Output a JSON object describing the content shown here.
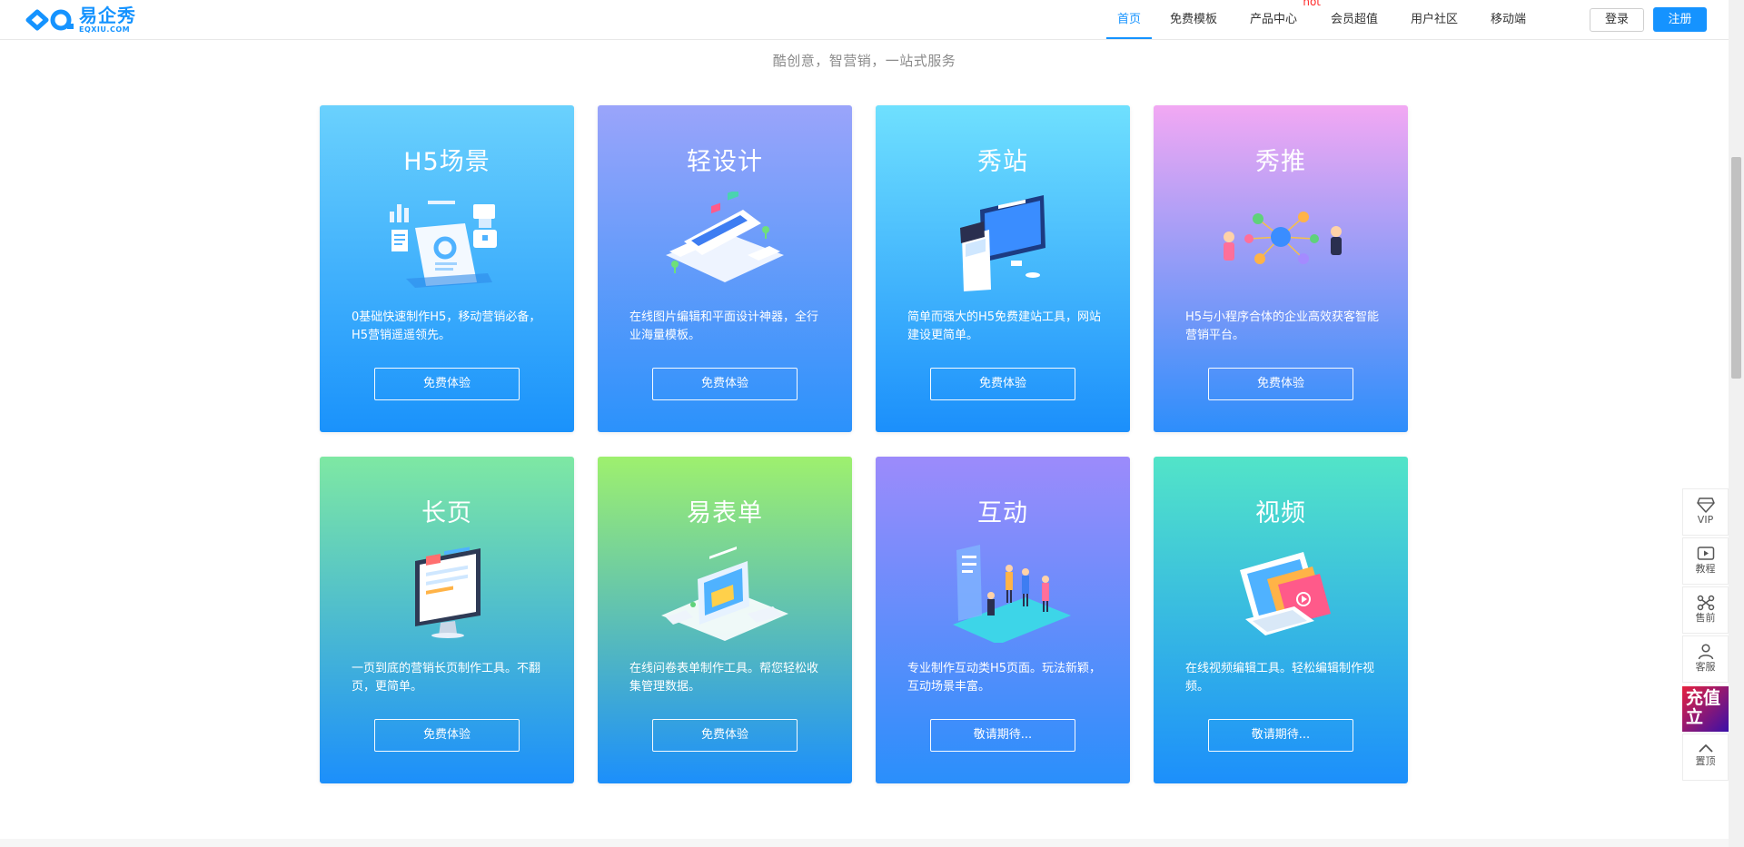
{
  "header": {
    "logo_cn": "易企秀",
    "logo_en": "EQXIU.COM",
    "nav": [
      {
        "label": "首页",
        "active": true
      },
      {
        "label": "免费模板",
        "active": false
      },
      {
        "label": "产品中心",
        "badge": "hot",
        "active": false
      },
      {
        "label": "会员超值",
        "active": false
      },
      {
        "label": "用户社区",
        "active": false
      },
      {
        "label": "移动端",
        "active": false
      }
    ],
    "login_label": "登录",
    "register_label": "注册"
  },
  "slogan": "酷创意，智营销，一站式服务",
  "cards": [
    {
      "title": "H5场景",
      "desc": "0基础快速制作H5，移动营销必备，H5营销遥遥领先。",
      "button": "免费体验",
      "icon": "h5-scene-illustration"
    },
    {
      "title": "轻设计",
      "desc": "在线图片编辑和平面设计神器，全行业海量模板。",
      "button": "免费体验",
      "icon": "light-design-illustration"
    },
    {
      "title": "秀站",
      "desc": "简单而强大的H5免费建站工具，网站建设更简单。",
      "button": "免费体验",
      "icon": "site-builder-illustration"
    },
    {
      "title": "秀推",
      "desc": "H5与小程序合体的企业高效获客智能营销平台。",
      "button": "免费体验",
      "icon": "marketing-network-illustration"
    },
    {
      "title": "长页",
      "desc": "一页到底的营销长页制作工具。不翻页，更简单。",
      "button": "免费体验",
      "icon": "long-page-illustration"
    },
    {
      "title": "易表单",
      "desc": "在线问卷表单制作工具。帮您轻松收集管理数据。",
      "button": "免费体验",
      "icon": "form-illustration"
    },
    {
      "title": "互动",
      "desc": "专业制作互动类H5页面。玩法新颖，互动场景丰富。",
      "button": "敬请期待...",
      "icon": "interactive-illustration"
    },
    {
      "title": "视频",
      "desc": "在线视频编辑工具。轻松编辑制作视频。",
      "button": "敬请期待...",
      "icon": "video-illustration"
    }
  ],
  "float_bar": {
    "vip": "VIP",
    "tutorial": "教程",
    "presale": "售前",
    "service": "客服",
    "recharge": "充值立",
    "top": "置顶"
  },
  "colors": {
    "brand": "#1593ff",
    "hot": "#ff2b2b"
  }
}
